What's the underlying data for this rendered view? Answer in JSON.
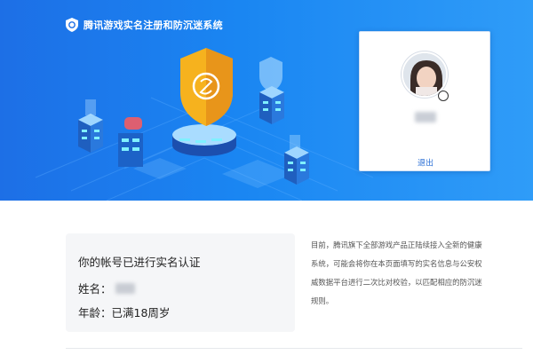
{
  "banner": {
    "title": "腾讯游戏实名注册和防沉迷系统",
    "colors": {
      "bg_start": "#1d6fe6",
      "bg_end": "#2f9cf8",
      "shield_gold": "#f6b21e"
    }
  },
  "user_card": {
    "logout_label": "退出"
  },
  "verification": {
    "heading": "你的帐号已进行实名认证",
    "name_label": "姓名：",
    "age_label": "年龄：",
    "age_value": "已满18周岁"
  },
  "description": {
    "lines": [
      "目前，腾讯旗下全部游戏产品正陆续接入全新的健康",
      "系统，可能会将你在本页面填写的实名信息与公安权",
      "威数据平台进行二次比对校验，以匹配相应的防沉迷",
      "规则。"
    ]
  },
  "icons": {
    "brand": "shield-logo-icon",
    "hero": "gold-shield-icon"
  }
}
